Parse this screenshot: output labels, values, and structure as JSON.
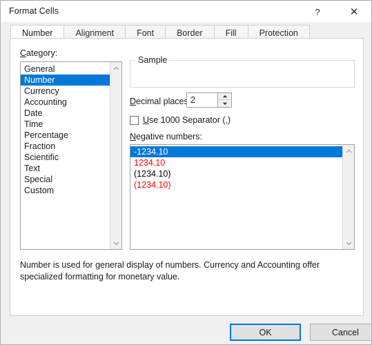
{
  "window": {
    "title": "Format Cells",
    "help_icon": "question-mark-icon",
    "help_glyph": "?",
    "close_icon": "close-icon",
    "close_glyph": "✕"
  },
  "tabs": [
    {
      "label": "Number",
      "active": true
    },
    {
      "label": "Alignment",
      "active": false
    },
    {
      "label": "Font",
      "active": false
    },
    {
      "label": "Border",
      "active": false
    },
    {
      "label": "Fill",
      "active": false
    },
    {
      "label": "Protection",
      "active": false
    }
  ],
  "category": {
    "label": "Category:",
    "label_accesskey": "C",
    "items": [
      "General",
      "Number",
      "Currency",
      "Accounting",
      "Date",
      "Time",
      "Percentage",
      "Fraction",
      "Scientific",
      "Text",
      "Special",
      "Custom"
    ],
    "selected": "Number",
    "selected_index": 1
  },
  "sample": {
    "legend": "Sample",
    "value": ""
  },
  "decimal_places": {
    "label": "Decimal places:",
    "label_accesskey": "D",
    "value": "2",
    "spin_up_icon": "spinner-up-arrow-icon",
    "spin_down_icon": "spinner-down-arrow-icon"
  },
  "thousands_separator": {
    "label": "Use 1000 Separator (,)",
    "label_accesskey": "U",
    "checked": false
  },
  "negative_numbers": {
    "label": "Negative numbers:",
    "label_accesskey": "N",
    "items": [
      {
        "text": "-1234.10",
        "color": "#000000",
        "selected": true
      },
      {
        "text": "1234.10",
        "color": "#ff0000",
        "selected": false
      },
      {
        "text": "(1234.10)",
        "color": "#000000",
        "selected": false
      },
      {
        "text": "(1234.10)",
        "color": "#ff0000",
        "selected": false
      }
    ],
    "selected_index": 0
  },
  "description": "Number is used for general display of numbers.  Currency and Accounting offer specialized formatting for monetary value.",
  "footer": {
    "ok_label": "OK",
    "cancel_label": "Cancel",
    "default_button": "OK"
  },
  "colors": {
    "selection_blue": "#0078d7",
    "negative_red": "#ff0000",
    "dialog_background": "#f0f0f0",
    "panel_background": "#ffffff"
  },
  "scrollbars": {
    "up_icon": "chevron-up-icon",
    "down_icon": "chevron-down-icon"
  }
}
